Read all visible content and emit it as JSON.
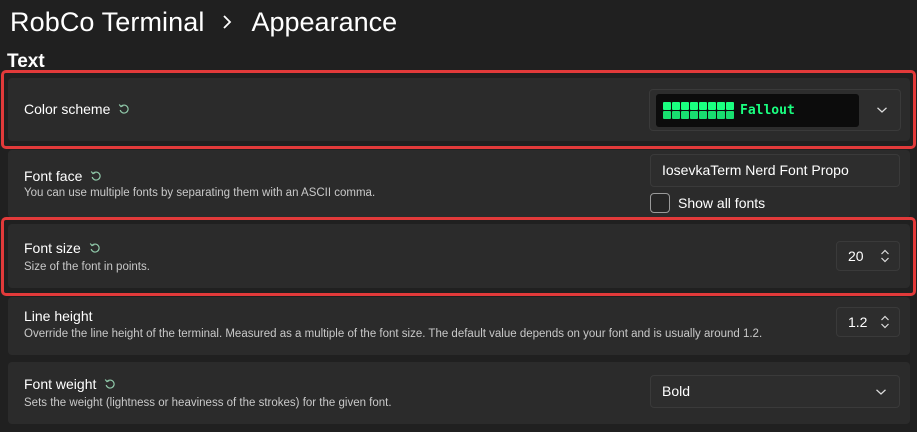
{
  "header": {
    "breadcrumb_root": "RobCo Terminal",
    "breadcrumb_current": "Appearance",
    "separator_icon": "chevron-right-icon"
  },
  "section": {
    "title": "Text"
  },
  "color_scheme": {
    "label": "Color scheme",
    "selected": "Fallout",
    "swatch_color": "#1aff80",
    "highlighted": true
  },
  "font_face": {
    "label": "Font face",
    "description": "You can use multiple fonts by separating them with an ASCII comma.",
    "value": "IosevkaTerm Nerd Font Propo",
    "show_all_label": "Show all fonts",
    "show_all_checked": false
  },
  "font_size": {
    "label": "Font size",
    "description": "Size of the font in points.",
    "value": "20",
    "highlighted": true
  },
  "line_height": {
    "label": "Line height",
    "description": "Override the line height of the terminal. Measured as a multiple of the font size. The default value depends on your font and is usually around 1.2.",
    "value": "1.2"
  },
  "font_weight": {
    "label": "Font weight",
    "description": "Sets the weight (lightness or heaviness of the strokes) for the given font.",
    "value": "Bold"
  },
  "colors": {
    "highlight_border": "#e23a3a",
    "scheme_green": "#1aff80",
    "reset_icon_color": "#8fc7a8"
  }
}
